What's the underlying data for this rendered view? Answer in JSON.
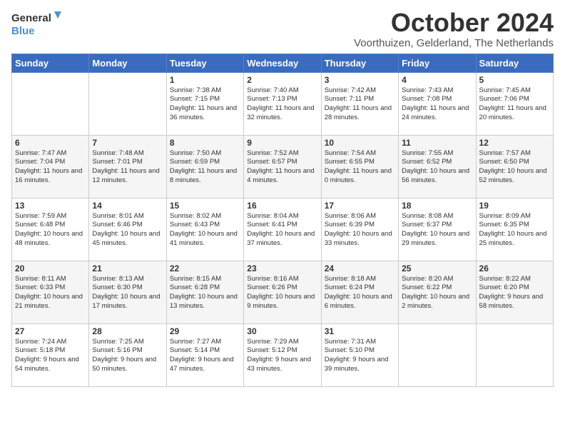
{
  "logo": {
    "line1": "General",
    "line2": "Blue"
  },
  "title": "October 2024",
  "subtitle": "Voorthuizen, Gelderland, The Netherlands",
  "days_of_week": [
    "Sunday",
    "Monday",
    "Tuesday",
    "Wednesday",
    "Thursday",
    "Friday",
    "Saturday"
  ],
  "weeks": [
    [
      {
        "day": "",
        "info": ""
      },
      {
        "day": "",
        "info": ""
      },
      {
        "day": "1",
        "info": "Sunrise: 7:38 AM\nSunset: 7:15 PM\nDaylight: 11 hours\nand 36 minutes."
      },
      {
        "day": "2",
        "info": "Sunrise: 7:40 AM\nSunset: 7:13 PM\nDaylight: 11 hours\nand 32 minutes."
      },
      {
        "day": "3",
        "info": "Sunrise: 7:42 AM\nSunset: 7:11 PM\nDaylight: 11 hours\nand 28 minutes."
      },
      {
        "day": "4",
        "info": "Sunrise: 7:43 AM\nSunset: 7:08 PM\nDaylight: 11 hours\nand 24 minutes."
      },
      {
        "day": "5",
        "info": "Sunrise: 7:45 AM\nSunset: 7:06 PM\nDaylight: 11 hours\nand 20 minutes."
      }
    ],
    [
      {
        "day": "6",
        "info": "Sunrise: 7:47 AM\nSunset: 7:04 PM\nDaylight: 11 hours\nand 16 minutes."
      },
      {
        "day": "7",
        "info": "Sunrise: 7:48 AM\nSunset: 7:01 PM\nDaylight: 11 hours\nand 12 minutes."
      },
      {
        "day": "8",
        "info": "Sunrise: 7:50 AM\nSunset: 6:59 PM\nDaylight: 11 hours\nand 8 minutes."
      },
      {
        "day": "9",
        "info": "Sunrise: 7:52 AM\nSunset: 6:57 PM\nDaylight: 11 hours\nand 4 minutes."
      },
      {
        "day": "10",
        "info": "Sunrise: 7:54 AM\nSunset: 6:55 PM\nDaylight: 11 hours\nand 0 minutes."
      },
      {
        "day": "11",
        "info": "Sunrise: 7:55 AM\nSunset: 6:52 PM\nDaylight: 10 hours\nand 56 minutes."
      },
      {
        "day": "12",
        "info": "Sunrise: 7:57 AM\nSunset: 6:50 PM\nDaylight: 10 hours\nand 52 minutes."
      }
    ],
    [
      {
        "day": "13",
        "info": "Sunrise: 7:59 AM\nSunset: 6:48 PM\nDaylight: 10 hours\nand 48 minutes."
      },
      {
        "day": "14",
        "info": "Sunrise: 8:01 AM\nSunset: 6:46 PM\nDaylight: 10 hours\nand 45 minutes."
      },
      {
        "day": "15",
        "info": "Sunrise: 8:02 AM\nSunset: 6:43 PM\nDaylight: 10 hours\nand 41 minutes."
      },
      {
        "day": "16",
        "info": "Sunrise: 8:04 AM\nSunset: 6:41 PM\nDaylight: 10 hours\nand 37 minutes."
      },
      {
        "day": "17",
        "info": "Sunrise: 8:06 AM\nSunset: 6:39 PM\nDaylight: 10 hours\nand 33 minutes."
      },
      {
        "day": "18",
        "info": "Sunrise: 8:08 AM\nSunset: 6:37 PM\nDaylight: 10 hours\nand 29 minutes."
      },
      {
        "day": "19",
        "info": "Sunrise: 8:09 AM\nSunset: 6:35 PM\nDaylight: 10 hours\nand 25 minutes."
      }
    ],
    [
      {
        "day": "20",
        "info": "Sunrise: 8:11 AM\nSunset: 6:33 PM\nDaylight: 10 hours\nand 21 minutes."
      },
      {
        "day": "21",
        "info": "Sunrise: 8:13 AM\nSunset: 6:30 PM\nDaylight: 10 hours\nand 17 minutes."
      },
      {
        "day": "22",
        "info": "Sunrise: 8:15 AM\nSunset: 6:28 PM\nDaylight: 10 hours\nand 13 minutes."
      },
      {
        "day": "23",
        "info": "Sunrise: 8:16 AM\nSunset: 6:26 PM\nDaylight: 10 hours\nand 9 minutes."
      },
      {
        "day": "24",
        "info": "Sunrise: 8:18 AM\nSunset: 6:24 PM\nDaylight: 10 hours\nand 6 minutes."
      },
      {
        "day": "25",
        "info": "Sunrise: 8:20 AM\nSunset: 6:22 PM\nDaylight: 10 hours\nand 2 minutes."
      },
      {
        "day": "26",
        "info": "Sunrise: 8:22 AM\nSunset: 6:20 PM\nDaylight: 9 hours\nand 58 minutes."
      }
    ],
    [
      {
        "day": "27",
        "info": "Sunrise: 7:24 AM\nSunset: 5:18 PM\nDaylight: 9 hours\nand 54 minutes."
      },
      {
        "day": "28",
        "info": "Sunrise: 7:25 AM\nSunset: 5:16 PM\nDaylight: 9 hours\nand 50 minutes."
      },
      {
        "day": "29",
        "info": "Sunrise: 7:27 AM\nSunset: 5:14 PM\nDaylight: 9 hours\nand 47 minutes."
      },
      {
        "day": "30",
        "info": "Sunrise: 7:29 AM\nSunset: 5:12 PM\nDaylight: 9 hours\nand 43 minutes."
      },
      {
        "day": "31",
        "info": "Sunrise: 7:31 AM\nSunset: 5:10 PM\nDaylight: 9 hours\nand 39 minutes."
      },
      {
        "day": "",
        "info": ""
      },
      {
        "day": "",
        "info": ""
      }
    ]
  ]
}
